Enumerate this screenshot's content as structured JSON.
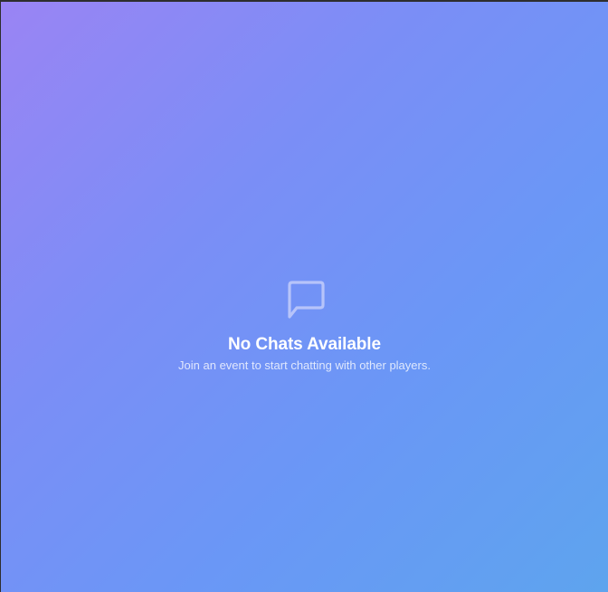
{
  "empty_state": {
    "icon": "chat-bubble-icon",
    "title": "No Chats Available",
    "subtitle": "Join an event to start chatting with other players."
  },
  "colors": {
    "gradient_start": "#9a84f4",
    "gradient_end": "#5ea4ee",
    "title_color": "#ffffff",
    "icon_color": "#c9cdf7"
  }
}
